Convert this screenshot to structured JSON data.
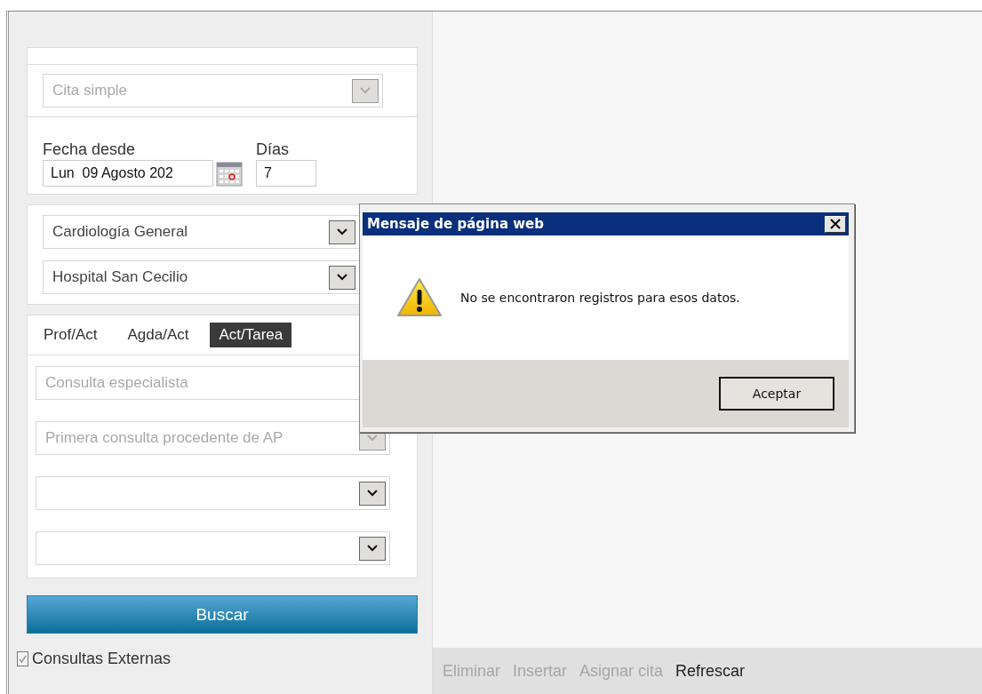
{
  "form": {
    "appointment_type": {
      "kind": "select",
      "value": "Cita simple",
      "disabled": true
    },
    "date_label": "Fecha desde",
    "date_value": "Lun  09 Agosto 202",
    "days_label": "Días",
    "days_value": "7",
    "location_fields": [
      {
        "kind": "select",
        "value": "Cardiología General",
        "disabled": false
      },
      {
        "kind": "select",
        "value": "Hospital San Cecilio",
        "disabled": false
      }
    ],
    "tabs": [
      {
        "label": "Prof/Act",
        "selected": false
      },
      {
        "label": "Agda/Act",
        "selected": false
      },
      {
        "label": "Act/Tarea",
        "selected": true
      }
    ],
    "activity_fields": [
      {
        "kind": "text",
        "value": "Consulta especialista",
        "disabled": true
      },
      {
        "kind": "select",
        "value": "Primera consulta procedente de AP",
        "disabled": true
      },
      {
        "kind": "select",
        "disabled": false
      },
      {
        "kind": "select",
        "disabled": false
      }
    ],
    "search_button": "Buscar",
    "external": {
      "label": "Consultas Externas",
      "checked": true
    }
  },
  "toolbar": [
    {
      "label": "Eliminar",
      "disabled": true
    },
    {
      "label": "Insertar",
      "disabled": true
    },
    {
      "label": "Asignar cita",
      "disabled": true
    },
    {
      "label": "Refrescar",
      "disabled": false
    }
  ],
  "dialog": {
    "title": "Mensaje de página web",
    "message": "No se encontraron registros para esos datos.",
    "button": "Aceptar"
  }
}
